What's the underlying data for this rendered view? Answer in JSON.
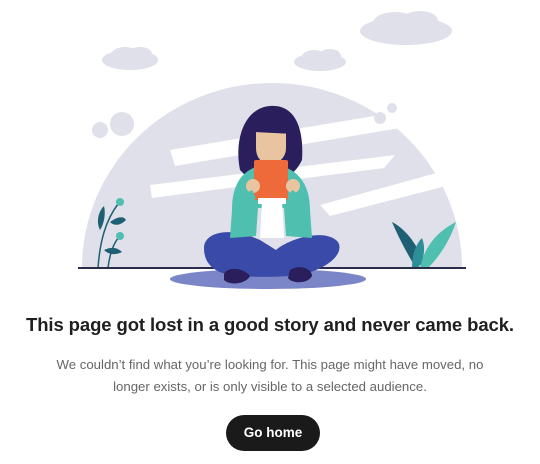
{
  "error": {
    "headline": "This page got lost in a good story and never came back.",
    "message": "We couldn’t find what you’re looking for. This page might have moved, no longer exists, or is only visible to a selected audience."
  },
  "actions": {
    "go_home_label": "Go home"
  },
  "illustration": {
    "subject": "person-reading-book-icon",
    "colors": {
      "sky_shape": "#dfe0ea",
      "hair": "#2a1f5c",
      "skin": "#e8c4a0",
      "jacket": "#4fbfb0",
      "book": "#ee6a3a",
      "pants": "#3a4aa8",
      "mat": "#7b86c8",
      "plant_dark": "#1f5f73",
      "plant_light": "#4fbfb0",
      "ground_line": "#2b2b4a"
    }
  },
  "colors": {
    "button_bg": "#1a1a1a",
    "button_text": "#ffffff",
    "headline": "#1f1f1f",
    "message": "#666666"
  }
}
